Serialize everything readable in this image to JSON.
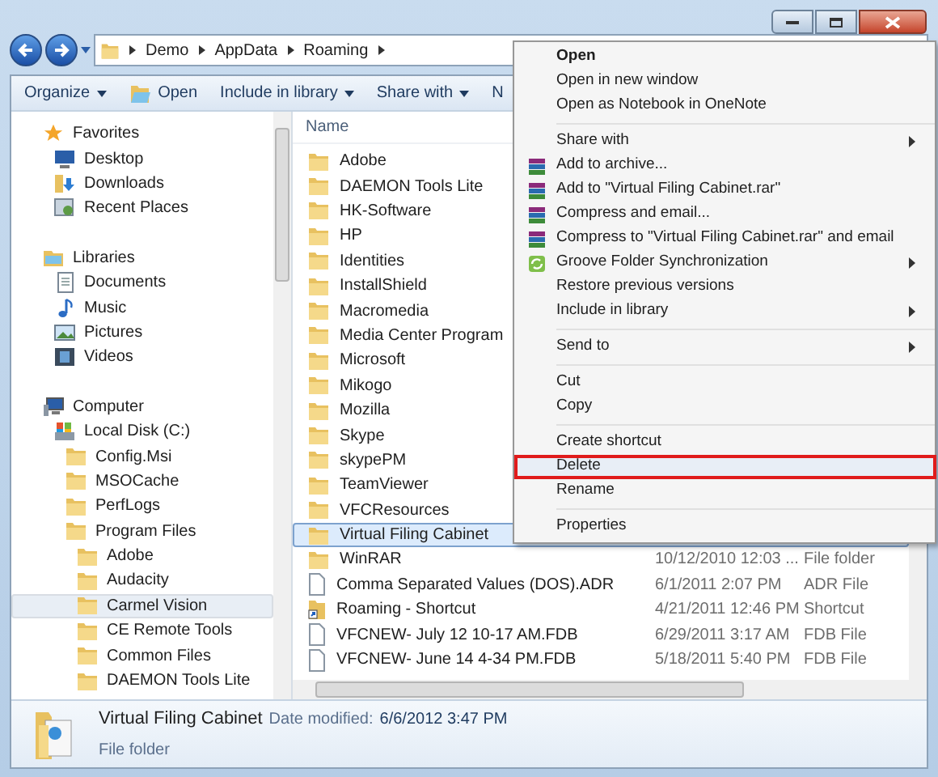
{
  "breadcrumb": [
    "Demo",
    "AppData",
    "Roaming"
  ],
  "toolbar": [
    {
      "label": "Organize",
      "kind": "dropdown"
    },
    {
      "label": "Open",
      "kind": "open"
    },
    {
      "label": "Include in library",
      "kind": "dropdown"
    },
    {
      "label": "Share with",
      "kind": "dropdown"
    },
    {
      "label": "N",
      "kind": "plain"
    }
  ],
  "nav": [
    {
      "label": "Favorites",
      "kind": "star",
      "selected": false,
      "children": [
        {
          "label": "Desktop",
          "kind": "desktop",
          "selected": false
        },
        {
          "label": "Downloads",
          "kind": "downloads",
          "selected": false
        },
        {
          "label": "Recent Places",
          "kind": "recent",
          "selected": false
        }
      ]
    },
    {
      "label": "Libraries",
      "kind": "library",
      "selected": false,
      "children": [
        {
          "label": "Documents",
          "kind": "documents",
          "selected": false
        },
        {
          "label": "Music",
          "kind": "music",
          "selected": false
        },
        {
          "label": "Pictures",
          "kind": "pictures",
          "selected": false
        },
        {
          "label": "Videos",
          "kind": "videos",
          "selected": false
        }
      ]
    },
    {
      "label": "Computer",
      "kind": "computer",
      "selected": false,
      "children": [
        {
          "label": "Local Disk (C:)",
          "kind": "disk",
          "selected": false,
          "children": [
            {
              "label": "Config.Msi",
              "kind": "folder",
              "selected": false
            },
            {
              "label": "MSOCache",
              "kind": "folder",
              "selected": false
            },
            {
              "label": "PerfLogs",
              "kind": "folder",
              "selected": false
            },
            {
              "label": "Program Files",
              "kind": "folder",
              "selected": false,
              "children": [
                {
                  "label": "Adobe",
                  "kind": "folder",
                  "selected": false
                },
                {
                  "label": "Audacity",
                  "kind": "folder",
                  "selected": false
                },
                {
                  "label": "Carmel Vision",
                  "kind": "folder",
                  "selected": true
                },
                {
                  "label": "CE Remote Tools",
                  "kind": "folder",
                  "selected": false
                },
                {
                  "label": "Common Files",
                  "kind": "folder",
                  "selected": false
                },
                {
                  "label": "DAEMON Tools Lite",
                  "kind": "folder",
                  "selected": false
                }
              ]
            }
          ]
        }
      ]
    }
  ],
  "column_header": "Name",
  "files": [
    {
      "name": "Adobe",
      "kind": "folder",
      "selected": false
    },
    {
      "name": "DAEMON Tools Lite",
      "kind": "folder",
      "selected": false
    },
    {
      "name": "HK-Software",
      "kind": "folder",
      "selected": false
    },
    {
      "name": "HP",
      "kind": "folder",
      "selected": false
    },
    {
      "name": "Identities",
      "kind": "folder",
      "selected": false
    },
    {
      "name": "InstallShield",
      "kind": "folder",
      "selected": false
    },
    {
      "name": "Macromedia",
      "kind": "folder",
      "selected": false
    },
    {
      "name": "Media Center Program",
      "kind": "folder",
      "selected": false
    },
    {
      "name": "Microsoft",
      "kind": "folder",
      "selected": false
    },
    {
      "name": "Mikogo",
      "kind": "folder",
      "selected": false
    },
    {
      "name": "Mozilla",
      "kind": "folder",
      "selected": false
    },
    {
      "name": "Skype",
      "kind": "folder",
      "selected": false
    },
    {
      "name": "skypePM",
      "kind": "folder",
      "selected": false
    },
    {
      "name": "TeamViewer",
      "kind": "folder",
      "selected": false
    },
    {
      "name": "VFCResources",
      "kind": "folder",
      "selected": false
    },
    {
      "name": "Virtual Filing Cabinet",
      "kind": "folder",
      "selected": true
    },
    {
      "name": "WinRAR",
      "kind": "folder",
      "selected": false,
      "date": "10/12/2010 12:03 ...",
      "type": "File folder"
    },
    {
      "name": "Comma Separated Values (DOS).ADR",
      "kind": "file",
      "selected": false,
      "date": "6/1/2011 2:07 PM",
      "type": "ADR File"
    },
    {
      "name": "Roaming - Shortcut",
      "kind": "shortcut",
      "selected": false,
      "date": "4/21/2011 12:46 PM",
      "type": "Shortcut"
    },
    {
      "name": "VFCNEW- July 12 10-17 AM.FDB",
      "kind": "file",
      "selected": false,
      "date": "6/29/2011 3:17 AM",
      "type": "FDB File"
    },
    {
      "name": "VFCNEW- June 14 4-34 PM.FDB",
      "kind": "file",
      "selected": false,
      "date": "5/18/2011 5:40 PM",
      "type": "FDB File"
    }
  ],
  "menu": [
    [
      {
        "label": "Open",
        "kind": "plain",
        "bold": true,
        "submenu": false,
        "selected": false
      },
      {
        "label": "Open in new window",
        "kind": "plain",
        "bold": false,
        "submenu": false,
        "selected": false
      },
      {
        "label": "Open as Notebook in OneNote",
        "kind": "plain",
        "bold": false,
        "submenu": false,
        "selected": false
      }
    ],
    [
      {
        "label": "Share with",
        "kind": "plain",
        "bold": false,
        "submenu": true,
        "selected": false
      },
      {
        "label": "Add to archive...",
        "kind": "archive",
        "bold": false,
        "submenu": false,
        "selected": false
      },
      {
        "label": "Add to \"Virtual Filing Cabinet.rar\"",
        "kind": "archive",
        "bold": false,
        "submenu": false,
        "selected": false
      },
      {
        "label": "Compress and email...",
        "kind": "archive",
        "bold": false,
        "submenu": false,
        "selected": false
      },
      {
        "label": "Compress to \"Virtual Filing Cabinet.rar\" and email",
        "kind": "archive",
        "bold": false,
        "submenu": false,
        "selected": false
      },
      {
        "label": "Groove Folder Synchronization",
        "kind": "sync",
        "bold": false,
        "submenu": true,
        "selected": false
      },
      {
        "label": "Restore previous versions",
        "kind": "plain",
        "bold": false,
        "submenu": false,
        "selected": false
      },
      {
        "label": "Include in library",
        "kind": "plain",
        "bold": false,
        "submenu": true,
        "selected": false
      }
    ],
    [
      {
        "label": "Send to",
        "kind": "plain",
        "bold": false,
        "submenu": true,
        "selected": false
      }
    ],
    [
      {
        "label": "Cut",
        "kind": "plain",
        "bold": false,
        "submenu": false,
        "selected": false
      },
      {
        "label": "Copy",
        "kind": "plain",
        "bold": false,
        "submenu": false,
        "selected": false
      }
    ],
    [
      {
        "label": "Create shortcut",
        "kind": "plain",
        "bold": false,
        "submenu": false,
        "selected": false
      },
      {
        "label": "Delete",
        "kind": "plain",
        "bold": false,
        "submenu": false,
        "selected": true
      },
      {
        "label": "Rename",
        "kind": "plain",
        "bold": false,
        "submenu": false,
        "selected": false
      }
    ],
    [
      {
        "label": "Properties",
        "kind": "plain",
        "bold": false,
        "submenu": false,
        "selected": false
      }
    ]
  ],
  "details": {
    "name": "Virtual Filing Cabinet",
    "date_label": "Date modified:",
    "date": "6/6/2012 3:47 PM",
    "type": "File folder"
  }
}
